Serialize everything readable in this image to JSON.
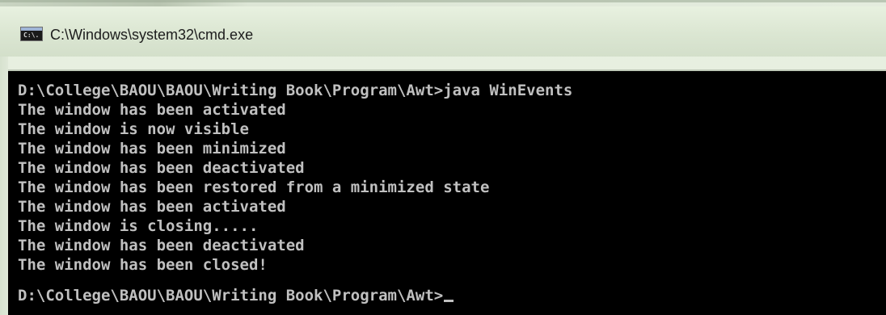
{
  "window": {
    "title": "C:\\Windows\\system32\\cmd.exe",
    "icon": "cmd-icon",
    "icon_text": "C:\\."
  },
  "console": {
    "command_line": "D:\\College\\BAOU\\BAOU\\Writing Book\\Program\\Awt>java WinEvents",
    "output": [
      "The window has been activated",
      "The window is now visible",
      "The window has been minimized",
      "The window has been deactivated",
      "The window has been restored from a minimized state",
      "The window has been activated",
      "The window is closing.....",
      "The window has been deactivated",
      "The window has been closed!"
    ],
    "prompt": "D:\\College\\BAOU\\BAOU\\Writing Book\\Program\\Awt>"
  },
  "colors": {
    "console_background": "#000000",
    "console_text": "#c0c0c0",
    "titlebar": "#dbe6d2"
  }
}
